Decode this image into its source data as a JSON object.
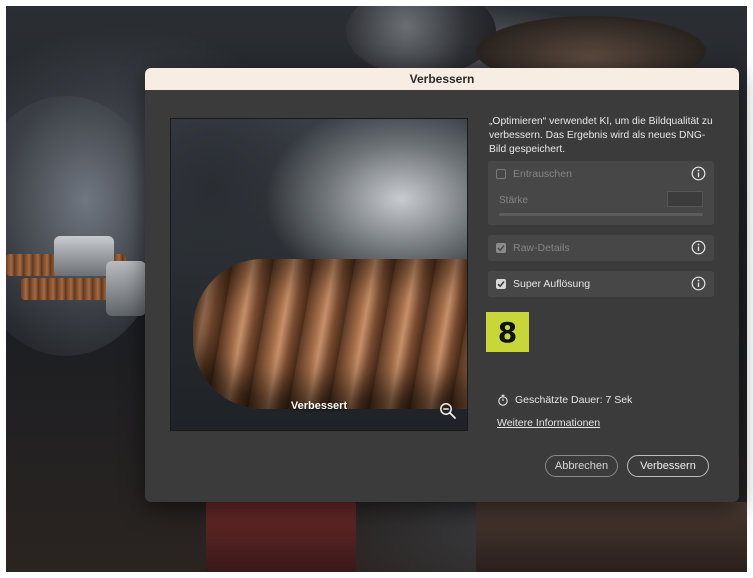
{
  "dialog": {
    "title": "Verbessern",
    "description": "„Optimieren“ verwendet KI, um die Bildqualität zu verbessern. Das Ergebnis wird als neues DNG-Bild gespeichert.",
    "preview": {
      "label": "Verbessert",
      "zoom_icon": "zoom-out-icon"
    },
    "options": {
      "denoise": {
        "label": "Entrauschen",
        "checked": false,
        "enabled": false,
        "strength_label": "Stärke"
      },
      "raw_details": {
        "label": "Raw-Details",
        "checked": true,
        "enabled": false
      },
      "super_resolution": {
        "label": "Super Auflösung",
        "checked": true,
        "enabled": true
      }
    },
    "badge": "8",
    "estimated_duration": "Geschätzte Dauer: 7 Sek",
    "more_info_link": "Weitere Informationen",
    "buttons": {
      "cancel": "Abbrechen",
      "confirm": "Verbessern"
    }
  },
  "colors": {
    "titlebar": "#f7ede2",
    "dialog_bg": "#3b3b3b",
    "panel_bg": "#474747",
    "badge_bg": "#c9d639"
  }
}
